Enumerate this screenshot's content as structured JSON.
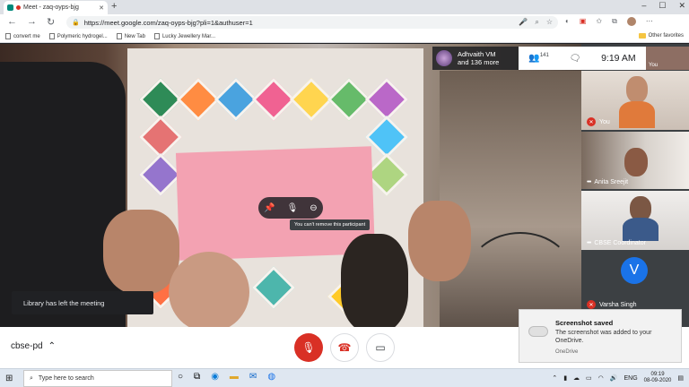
{
  "browser": {
    "tab_title": "Meet - zaq-oyps-bjg",
    "url": "https://meet.google.com/zaq-oyps-bjg?pli=1&authuser=1",
    "bookmarks": [
      "convert me",
      "Polymeric hydrogel...",
      "New Tab",
      "Lucky Jewellery Mar..."
    ],
    "other_favorites": "Other favorites"
  },
  "meet": {
    "presenter_name": "Adhvaith VM",
    "presenter_more": "and 136 more",
    "participant_count": "141",
    "time": "9:19 AM",
    "self_mini_label": "You",
    "tooltip": "You can't remove this participant",
    "left_toast": "Library has left the meeting",
    "tiles": [
      {
        "label": "You",
        "muted": true
      },
      {
        "label": "Anita Sreejit",
        "muted": false
      },
      {
        "label": "CBSE Coordinator",
        "muted": false
      },
      {
        "label": "Varsha Singh",
        "muted": true,
        "initial": "V"
      }
    ],
    "meeting_code": "cbse-pd",
    "accent_red": "#d93025",
    "accent_blue": "#1a73e8"
  },
  "notification": {
    "title": "Screenshot saved",
    "body": "The screenshot was added to your OneDrive.",
    "source": "OneDrive"
  },
  "taskbar": {
    "search_placeholder": "Type here to search",
    "language": "ENG",
    "time": "09:19",
    "date": "08-09-2020"
  }
}
